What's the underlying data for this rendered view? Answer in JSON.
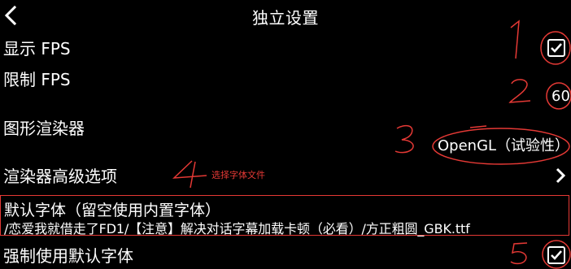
{
  "header": {
    "title": "独立设置",
    "back_icon": "chevron-left-icon"
  },
  "settings": {
    "show_fps": {
      "label": "显示 FPS",
      "checked": true
    },
    "limit_fps": {
      "label": "限制 FPS",
      "value": "60"
    },
    "renderer": {
      "label": "图形渲染器",
      "value": "OpenGL（试验性）"
    },
    "renderer_advanced": {
      "label": "渲染器高级选项",
      "icon": "chevron-right-icon"
    },
    "default_font": {
      "label": "默认字体（留空使用内置字体）",
      "path": "/恋爱我就借走了FD1/【注意】解决对话字幕加载卡顿（必看）/方正粗圆_GBK.ttf"
    },
    "force_default_font": {
      "label": "强制使用默认字体",
      "checked": true
    }
  },
  "annotations": {
    "note": "选择字体文件",
    "color": "#e53935"
  },
  "colors": {
    "background": "#000000",
    "text": "#ffffff",
    "annotation": "#e53935"
  }
}
